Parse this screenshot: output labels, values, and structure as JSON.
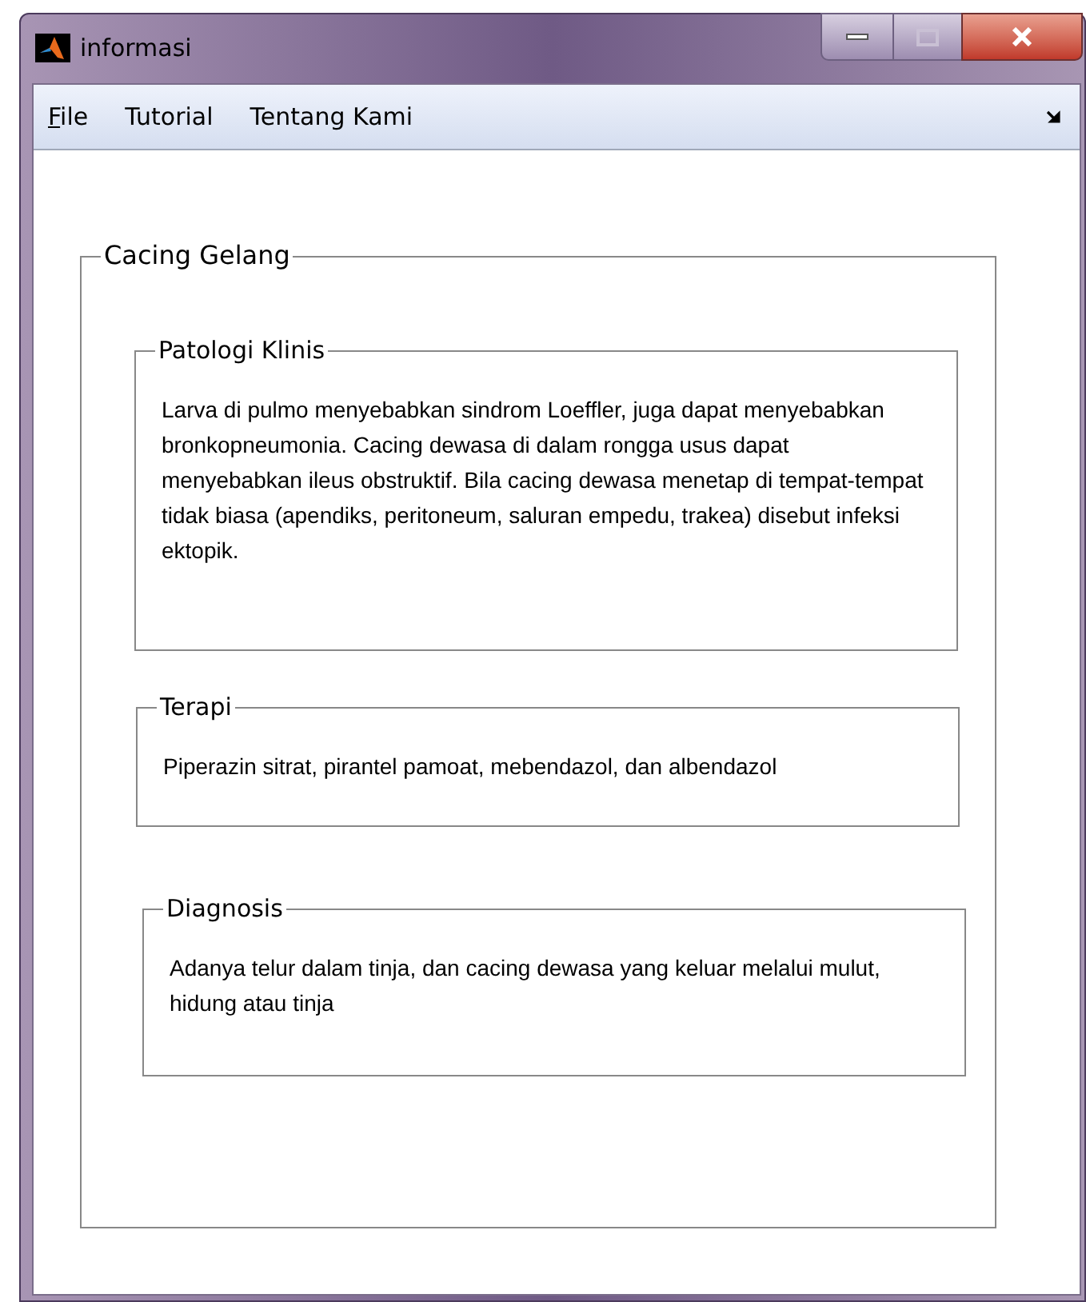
{
  "window": {
    "title": "informasi"
  },
  "menu": [
    {
      "label": "File",
      "mnemonic_first": true
    },
    {
      "label": "Tutorial",
      "mnemonic_first": false
    },
    {
      "label": "Tentang Kami",
      "mnemonic_first": false
    }
  ],
  "panel": {
    "title": "Cacing Gelang",
    "groups": [
      {
        "title": "Patologi Klinis",
        "text": "Larva di pulmo menyebabkan sindrom Loeffler, juga dapat menyebabkan bronkopneumonia. Cacing dewasa di dalam rongga usus dapat menyebabkan ileus obstruktif. Bila cacing dewasa menetap di tempat-tempat tidak biasa (apendiks, peritoneum, saluran empedu, trakea) disebut infeksi ektopik."
      },
      {
        "title": "Terapi",
        "text": "Piperazin sitrat, pirantel pamoat, mebendazol, dan albendazol"
      },
      {
        "title": "Diagnosis",
        "text": "Adanya telur dalam tinja, dan cacing dewasa yang keluar melalui mulut, hidung atau tinja"
      }
    ]
  }
}
